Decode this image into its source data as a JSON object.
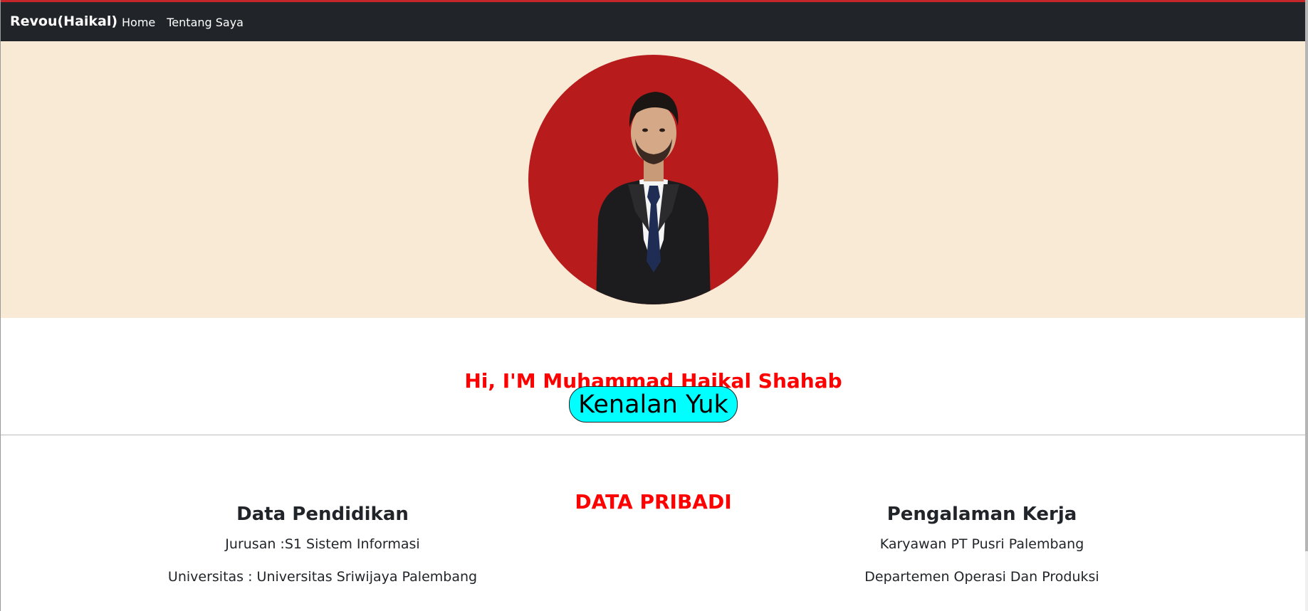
{
  "navbar": {
    "brand": "Revou(Haikal)",
    "links": [
      "Home",
      "Tentang Saya"
    ]
  },
  "hero": {
    "avatar_icon": "profile-photo"
  },
  "intro": {
    "greeting": "Hi, I'M Muhammad Haikal Shahab",
    "button_label": "Kenalan Yuk"
  },
  "profile": {
    "title": "DATA PRIBADI",
    "education": {
      "heading": "Data Pendidikan",
      "major": "Jurusan :S1 Sistem Informasi",
      "university": "Universitas : Universitas Sriwijaya Palembang"
    },
    "work": {
      "heading": "Pengalaman Kerja",
      "job": "Karyawan PT Pusri Palembang",
      "department": "Departemen Operasi Dan Produksi"
    }
  },
  "colors": {
    "navbar_bg": "#212529",
    "hero_bg": "#f9ead6",
    "avatar_bg": "#b71b1c",
    "accent_red": "#ff0000",
    "button_bg": "#00ffff"
  }
}
